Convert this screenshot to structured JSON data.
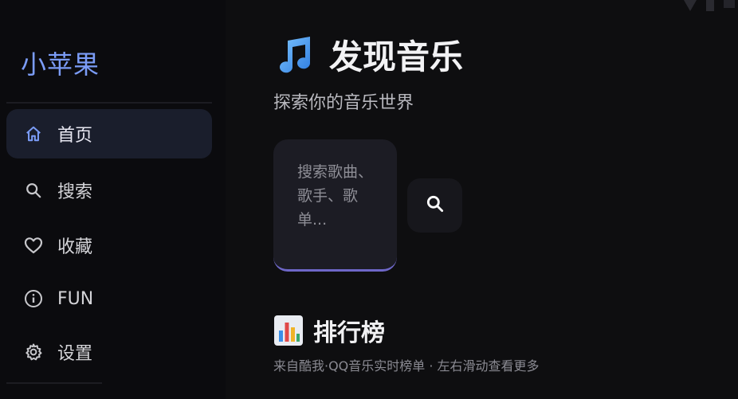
{
  "sidebar": {
    "brand": "小苹果",
    "items": [
      {
        "label": "首页",
        "icon": "home-icon",
        "active": true
      },
      {
        "label": "搜索",
        "icon": "search-icon",
        "active": false
      },
      {
        "label": "收藏",
        "icon": "heart-icon",
        "active": false
      },
      {
        "label": "FUN",
        "icon": "info-icon",
        "active": false
      },
      {
        "label": "设置",
        "icon": "gear-icon",
        "active": false
      }
    ]
  },
  "header": {
    "title_icon": "music-note-icon",
    "title": "发现音乐",
    "subtitle": "探索你的音乐世界"
  },
  "search": {
    "placeholder": "搜索歌曲、歌手、歌单...",
    "button_icon": "search-icon"
  },
  "chart_section": {
    "icon": "bar-chart-icon",
    "title": "排行榜",
    "caption": "来自酷我·QQ音乐实时榜单 · 左右滑动查看更多"
  },
  "colors": {
    "accent": "#7b9cf7",
    "active_bg": "#1a1e2c",
    "search_underline": "#6e67c8"
  }
}
